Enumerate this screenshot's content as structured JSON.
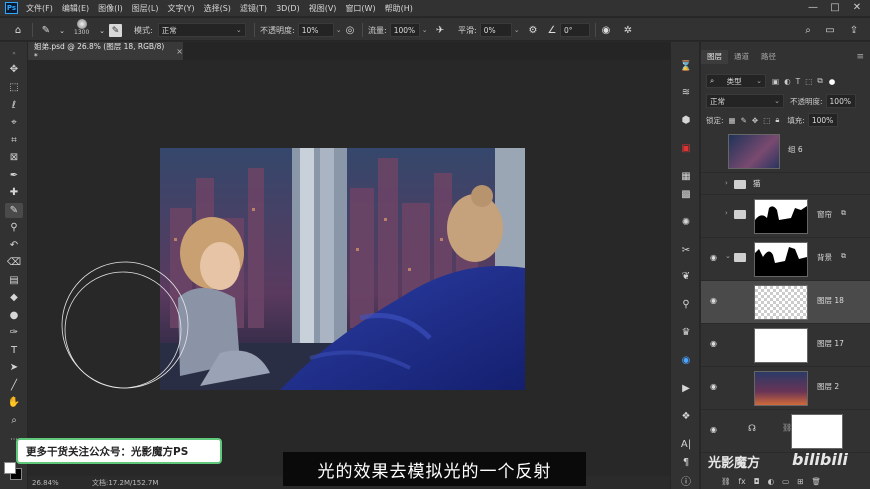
{
  "menubar": {
    "logo": "Ps",
    "items": [
      "文件(F)",
      "编辑(E)",
      "图像(I)",
      "图层(L)",
      "文字(Y)",
      "选择(S)",
      "滤镜(T)",
      "3D(D)",
      "视图(V)",
      "窗口(W)",
      "帮助(H)"
    ],
    "minimize": "—",
    "maximize": "□",
    "close": "✕"
  },
  "options": {
    "brush_size": "1300",
    "mode_label": "模式:",
    "mode_value": "正常",
    "opacity_label": "不透明度:",
    "opacity_value": "10%",
    "flow_label": "流量:",
    "flow_value": "100%",
    "smoothing_label": "平滑:",
    "smoothing_value": "0%",
    "angle_value": "0°"
  },
  "document": {
    "tab_title": "姐弟.psd @ 26.8% (图层 18, RGB/8) *",
    "close": "×"
  },
  "statusbar": {
    "zoom": "26.84%",
    "doc_info": "文档:17.2M/152.7M"
  },
  "layers_panel": {
    "tabs": [
      "图层",
      "通道",
      "路径"
    ],
    "filter_label": "类型",
    "blend_mode": "正常",
    "opacity_label": "不透明度:",
    "opacity_value": "100%",
    "lock_label": "锁定:",
    "fill_label": "填充:",
    "fill_value": "100%",
    "layers": [
      {
        "name": "组 6",
        "visible": false,
        "type": "group-merged"
      },
      {
        "name": "猫",
        "visible": false,
        "type": "folder"
      },
      {
        "name": "窗帘",
        "visible": false,
        "type": "folder-mask"
      },
      {
        "name": "背景",
        "visible": true,
        "type": "folder-mask"
      },
      {
        "name": "图层 18",
        "visible": true,
        "type": "transparent",
        "selected": true
      },
      {
        "name": "图层 17",
        "visible": true,
        "type": "white"
      },
      {
        "name": "图层 2",
        "visible": true,
        "type": "image"
      },
      {
        "name": "",
        "visible": true,
        "type": "adjustment"
      }
    ]
  },
  "overlay": {
    "promo": "更多干货关注公众号：光影魔方PS",
    "subtitle": "光的效果去模拟光的一个反射",
    "watermark1": "光影魔方",
    "watermark2": "bilibili"
  }
}
